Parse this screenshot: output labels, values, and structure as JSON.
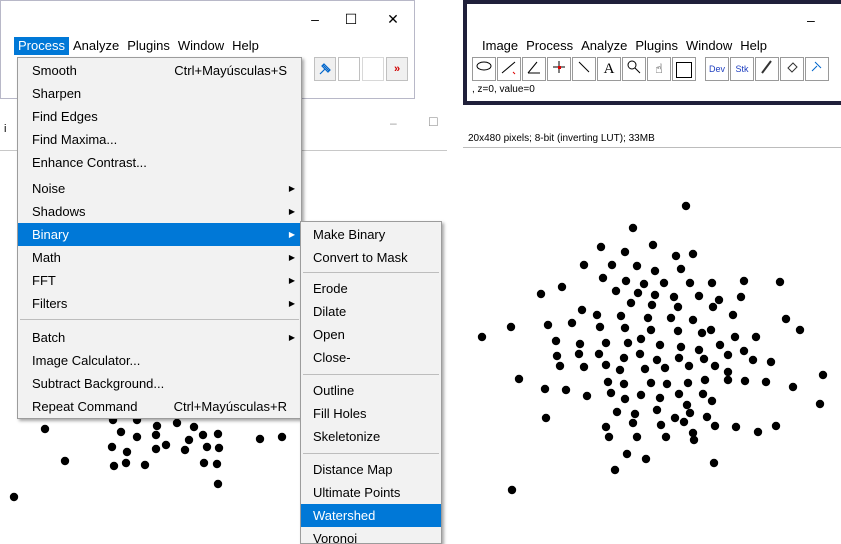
{
  "left_window": {
    "controls": {
      "minimize": "–",
      "maximize": "☐",
      "close": "✕"
    },
    "menubar": [
      "Process",
      "Analyze",
      "Plugins",
      "Window",
      "Help"
    ],
    "toolbar": {
      "tool_icon": "pushpin-icon",
      "more": "»"
    },
    "image_window": {
      "label": "i",
      "minimize": "–",
      "maximize": "☐"
    }
  },
  "right_window": {
    "controls": {
      "minimize": "–"
    },
    "menubar": [
      "Image",
      "Process",
      "Analyze",
      "Plugins",
      "Window",
      "Help"
    ],
    "toolbar": [
      "oval-icon",
      "line-icon",
      "angle-icon",
      "point-icon",
      "wand-icon",
      "text-icon",
      "magnifier-icon",
      "hand-icon",
      "color-picker-icon",
      "Dev",
      "Stk",
      "brush-icon",
      "flood-fill-icon",
      "pushpin-icon"
    ],
    "status": ", z=0, value=0",
    "image_info": "20x480 pixels; 8-bit (inverting LUT); 33MB"
  },
  "process_menu": {
    "items": [
      {
        "label": "Smooth",
        "shortcut": "Ctrl+Mayúsculas+S",
        "submenu": false
      },
      {
        "label": "Sharpen",
        "shortcut": "",
        "submenu": false
      },
      {
        "label": "Find Edges",
        "shortcut": "",
        "submenu": false
      },
      {
        "label": "Find Maxima...",
        "shortcut": "",
        "submenu": false
      },
      {
        "label": "Enhance Contrast...",
        "shortcut": "",
        "submenu": false
      },
      {
        "label": "Noise",
        "shortcut": "",
        "submenu": true
      },
      {
        "label": "Shadows",
        "shortcut": "",
        "submenu": true
      },
      {
        "label": "Binary",
        "shortcut": "",
        "submenu": true,
        "selected": true
      },
      {
        "label": "Math",
        "shortcut": "",
        "submenu": true
      },
      {
        "label": "FFT",
        "shortcut": "",
        "submenu": true
      },
      {
        "label": "Filters",
        "shortcut": "",
        "submenu": true
      },
      {
        "label": "Batch",
        "shortcut": "",
        "submenu": true
      },
      {
        "label": "Image Calculator...",
        "shortcut": "",
        "submenu": false
      },
      {
        "label": "Subtract Background...",
        "shortcut": "",
        "submenu": false
      },
      {
        "label": "Repeat Command",
        "shortcut": "Ctrl+Mayúsculas+R",
        "submenu": false
      }
    ]
  },
  "binary_menu": {
    "items": [
      {
        "label": "Make Binary"
      },
      {
        "label": "Convert to Mask"
      },
      {
        "label": "Erode"
      },
      {
        "label": "Dilate"
      },
      {
        "label": "Open"
      },
      {
        "label": "Close-"
      },
      {
        "label": "Outline"
      },
      {
        "label": "Fill Holes"
      },
      {
        "label": "Skeletonize"
      },
      {
        "label": "Distance Map"
      },
      {
        "label": "Ultimate Points"
      },
      {
        "label": "Watershed",
        "selected": true
      },
      {
        "label": "Voronoi"
      }
    ]
  },
  "colors": {
    "accent": "#0078d7",
    "menu_bg": "#f2f2f2",
    "frame_dark": "#20203a",
    "dot": "#000000"
  }
}
